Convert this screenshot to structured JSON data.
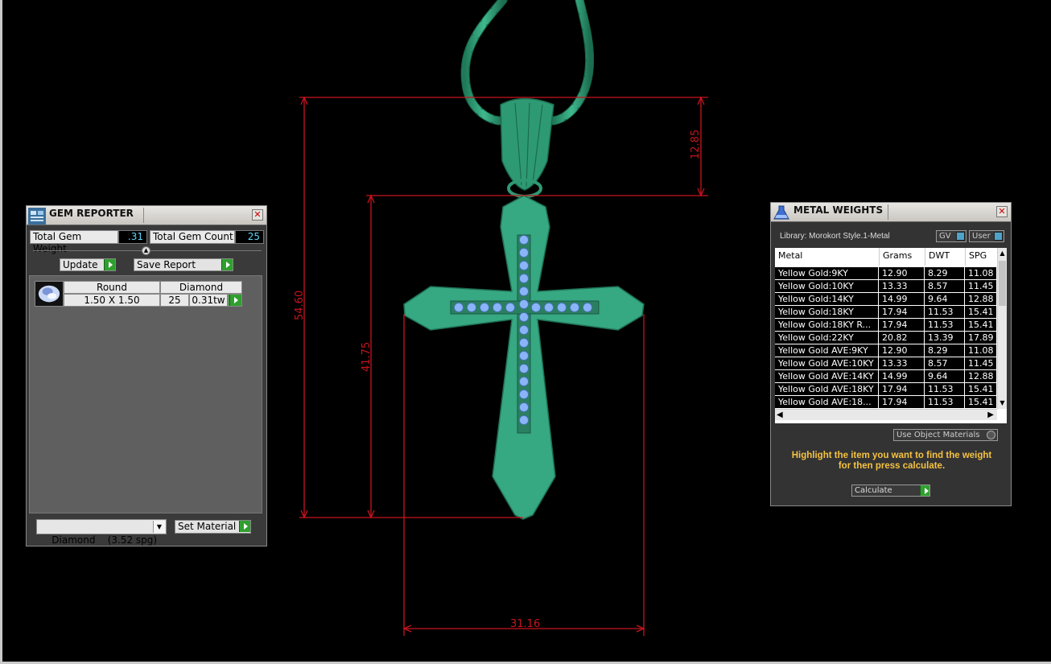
{
  "dimensions": {
    "overall_height": "54.60",
    "bail_height": "12.85",
    "cross_height": "41.75",
    "cross_width": "31.16"
  },
  "gem_reporter": {
    "title": "GEM REPORTER",
    "total_weight_label": "Total Gem Weight",
    "total_weight_value": ".31",
    "total_count_label": "Total Gem Count",
    "total_count_value": "25",
    "update_label": "Update",
    "save_report_label": "Save Report",
    "gem_row": {
      "shape": "Round",
      "type": "Diamond",
      "size": "1.50 X 1.50",
      "count": "25",
      "weight": "0.31tw"
    },
    "material_select": "Diamond    (3.52 spg)",
    "set_material_label": "Set Material"
  },
  "metal_weights": {
    "title": "METAL WEIGHTS",
    "library": "Library: Morokort Style.1-Metal",
    "gv_label": "GV",
    "user_label": "User",
    "columns": [
      "Metal",
      "Grams",
      "DWT",
      "SPG"
    ],
    "rows": [
      [
        "Yellow Gold:9KY",
        "12.90",
        "8.29",
        "11.08"
      ],
      [
        "Yellow Gold:10KY",
        "13.33",
        "8.57",
        "11.45"
      ],
      [
        "Yellow Gold:14KY",
        "14.99",
        "9.64",
        "12.88"
      ],
      [
        "Yellow Gold:18KY",
        "17.94",
        "11.53",
        "15.41"
      ],
      [
        "Yellow Gold:18KY R...",
        "17.94",
        "11.53",
        "15.41"
      ],
      [
        "Yellow Gold:22KY",
        "20.82",
        "13.39",
        "17.89"
      ],
      [
        "Yellow Gold AVE:9KY",
        "12.90",
        "8.29",
        "11.08"
      ],
      [
        "Yellow Gold AVE:10KY",
        "13.33",
        "8.57",
        "11.45"
      ],
      [
        "Yellow Gold AVE:14KY",
        "14.99",
        "9.64",
        "12.88"
      ],
      [
        "Yellow Gold AVE:18KY",
        "17.94",
        "11.53",
        "15.41"
      ],
      [
        "Yellow Gold AVE:18...",
        "17.94",
        "11.53",
        "15.41"
      ]
    ],
    "use_object_materials": "Use Object Materials",
    "hint": "Highlight the item you want to find the weight for then press calculate.",
    "calculate_label": "Calculate"
  },
  "colors": {
    "metal_green": "#36a882",
    "gem_blue": "#8ab4f8",
    "dimension_red": "#c8141e",
    "hint_yellow": "#f5c242",
    "value_cyan": "#5fd5f5"
  }
}
